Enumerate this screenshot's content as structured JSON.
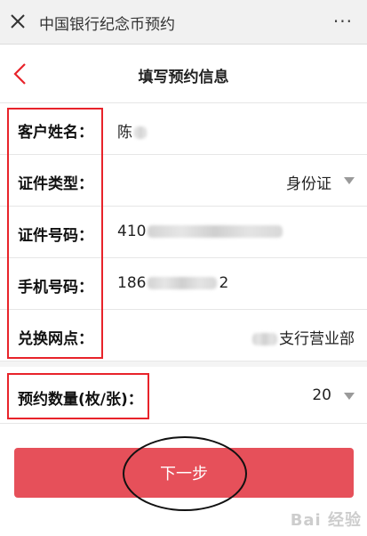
{
  "window": {
    "title": "中国银行纪念币预约",
    "more": "···"
  },
  "page": {
    "title": "填写预约信息"
  },
  "form": {
    "name_label": "客户姓名：",
    "name_value": "陈",
    "idtype_label": "证件类型：",
    "idtype_value": "身份证",
    "idnum_label": "证件号码：",
    "idnum_value": "410",
    "phone_label": "手机号码：",
    "phone_prefix": "186",
    "phone_suffix": "2",
    "branch_label": "兑换网点：",
    "branch_value": "支行营业部",
    "qty_label": "预约数量(枚/张)：",
    "qty_value": "20"
  },
  "actions": {
    "next_label": "下一步"
  },
  "watermark": "Bai 经验",
  "colors": {
    "annotation_red": "#e8232a",
    "button": "#e6505a",
    "back_arrow": "#e8232a"
  }
}
